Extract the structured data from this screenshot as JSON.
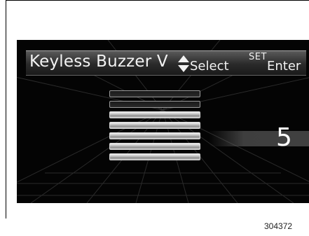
{
  "header": {
    "title": "Keyless Buzzer V",
    "select_label": "Select",
    "set_label": "SET",
    "enter_label": "Enter",
    "select_icon": "up-down-arrow-icon"
  },
  "setting": {
    "value": "5",
    "level": 5,
    "level_max": 7
  },
  "figure_id": "304372",
  "colors": {
    "screen_background": "#040404",
    "text": "#f2f2f2",
    "bar_active": "#bdbdbd"
  }
}
